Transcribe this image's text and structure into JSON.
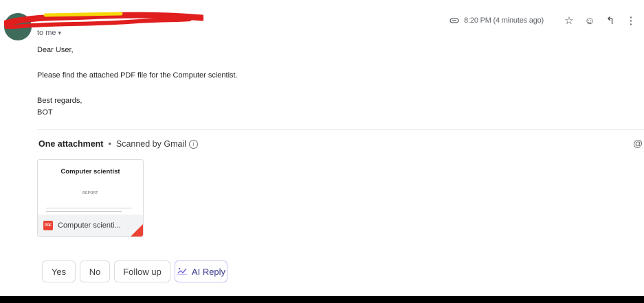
{
  "header": {
    "to": "to me",
    "time": "8:20 PM (4 minutes ago)",
    "icons": [
      "paperclip-icon",
      "star-icon",
      "emoji-icon",
      "reply-icon",
      "more-vert-icon"
    ]
  },
  "message": {
    "greeting": "Dear User,",
    "body": "Please find the attached PDF file for the Computer scientist.",
    "signoff": "Best regards,",
    "signature": "BOT"
  },
  "attachments": {
    "heading": "One attachment",
    "scanned": "Scanned by Gmail",
    "file": {
      "thumb_title": "Computer scientist",
      "thumb_subtitle": "REPORT",
      "type_badge": "PDF",
      "name": "Computer scienti..."
    }
  },
  "smart_replies": {
    "yes": "Yes",
    "no": "No",
    "follow_up": "Follow up",
    "ai_reply": "AI Reply"
  },
  "colors": {
    "pdf_red": "#ea4335",
    "avatar": "#3f6b5a",
    "ai_chip_border": "#c9c2f3"
  }
}
